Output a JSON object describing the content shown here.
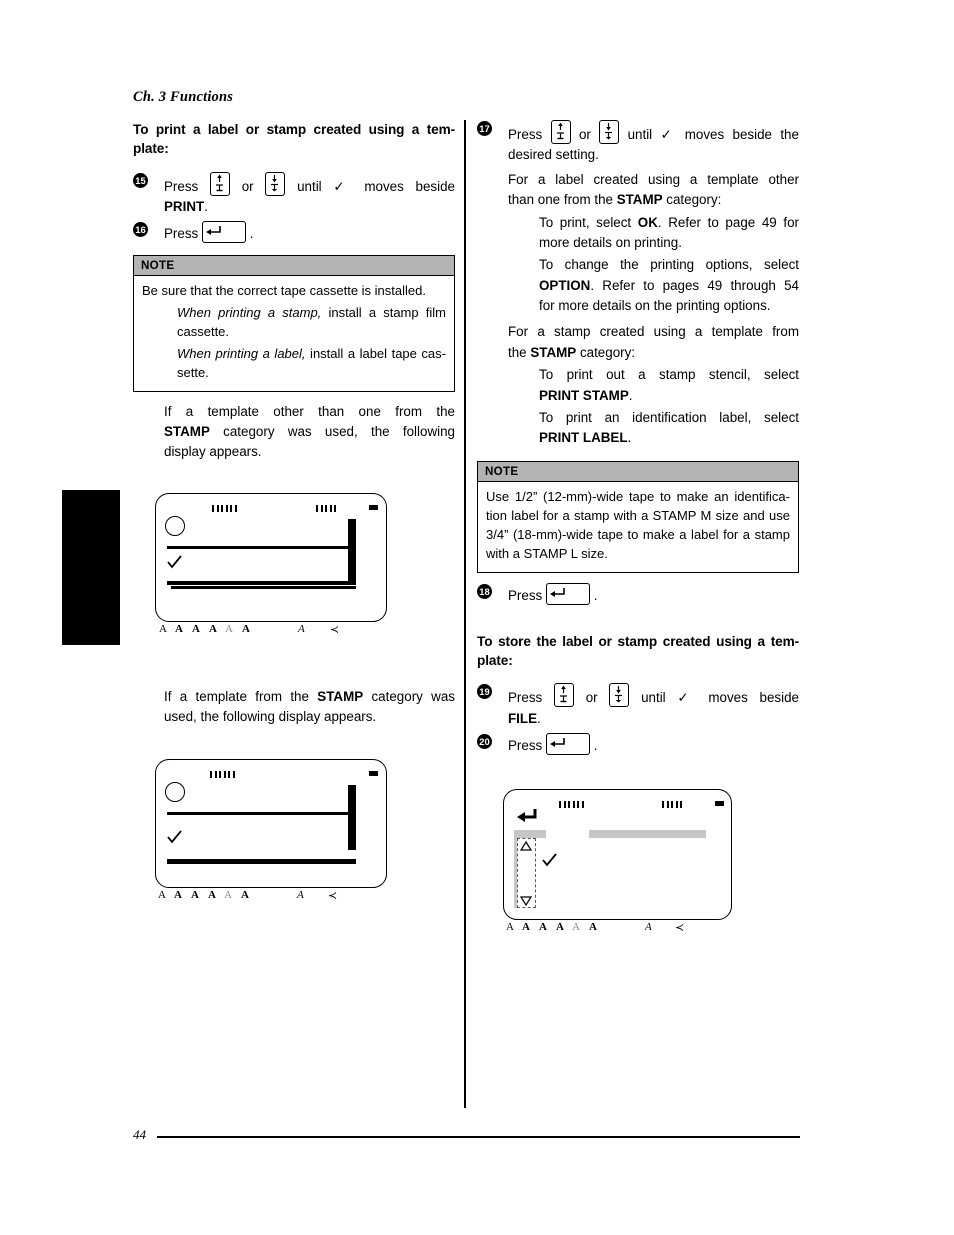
{
  "page": {
    "chapter_header": "Ch. 3 Functions",
    "page_number": "44"
  },
  "left_column": {
    "section_heading_line1": "To print a label or stamp created using a tem-",
    "section_heading_line2": "plate:",
    "step15": {
      "number": "15",
      "text_a": "Press",
      "text_b": "or",
      "text_c": "until ✓ moves beside",
      "text_d": "PRINT",
      "text_e": "."
    },
    "step16": {
      "number": "16",
      "text_a": "Press",
      "text_b": "."
    },
    "note": {
      "header": "NOTE",
      "line1": "Be sure that the correct tape cassette is installed.",
      "item1_em": "When printing a stamp,",
      "item1_rest": " install a stamp film",
      "item1_line2": "cassette.",
      "item2_em": "When printing a label,",
      "item2_rest": " install a label tape cas-",
      "item2_line2": "sette."
    },
    "para_after_note": {
      "line1_a": "If a template other than one from the",
      "line2_bold": "STAMP",
      "line2_rest": " category was used, the following",
      "line3": "display appears."
    },
    "para_stamp": {
      "line1_a": "If a template from the ",
      "line1_bold": "STAMP",
      "line1_b": " category was",
      "line2": "used, the following display appears."
    },
    "lcd1": {
      "name": "display-template-non-stamp",
      "icons": [
        "A",
        "A",
        "A",
        "A",
        "A",
        "A",
        "A",
        "≺"
      ]
    },
    "lcd2": {
      "name": "display-template-stamp",
      "icons": [
        "A",
        "A",
        "A",
        "A",
        "A",
        "A",
        "A",
        "≺"
      ]
    }
  },
  "right_column": {
    "step17": {
      "number": "17",
      "text_a": "Press",
      "text_b": "or",
      "text_c": "until ✓ moves beside the",
      "text_d": "desired setting."
    },
    "para_label": {
      "line1": "For a label created using a template other",
      "line2_a": "than one from the ",
      "line2_bold": "STAMP",
      "line2_b": " category:"
    },
    "sub_ok": {
      "line1_a": "To print, select ",
      "line1_bold": "OK",
      "line1_b": ". Refer to page 49 for",
      "line2": "more details on printing."
    },
    "sub_option": {
      "line1": "To change the printing options, select",
      "line2_bold": "OPTION",
      "line2_rest": ". Refer to pages 49 through 54",
      "line3": "for more details on the printing options."
    },
    "para_stamp": {
      "line1": "For a stamp created using a template from",
      "line2_a": "the ",
      "line2_bold": "STAMP",
      "line2_b": " category:"
    },
    "sub_print_stamp": {
      "line1": "To print out a stamp stencil, select",
      "line2_bold": "PRINT STAMP",
      "line2_rest": "."
    },
    "sub_print_label": {
      "line1": "To print an identification label, select",
      "line2_bold": "PRINT LABEL",
      "line2_rest": "."
    },
    "note": {
      "header": "NOTE",
      "line1": "Use 1/2” (12-mm)-wide tape to make an identifica-",
      "line2": "tion label for a stamp with a STAMP M size and use",
      "line3": "3/4” (18-mm)-wide tape to make a label for a stamp",
      "line4": "with a STAMP L size."
    },
    "step18": {
      "number": "18",
      "text_a": "Press",
      "text_b": "."
    },
    "section_heading_line1": "To store the label or stamp created using a tem-",
    "section_heading_line2": "plate:",
    "step19": {
      "number": "19",
      "text_a": "Press",
      "text_b": "or",
      "text_c": "until ✓ moves beside",
      "text_d": "FILE",
      "text_e": "."
    },
    "step20": {
      "number": "20",
      "text_a": "Press",
      "text_b": "."
    },
    "lcd3": {
      "name": "display-file-store",
      "icons": [
        "A",
        "A",
        "A",
        "A",
        "A",
        "A",
        "A",
        "≺"
      ]
    }
  },
  "icons": {
    "up_arrow": "up-arrow-key",
    "down_arrow": "down-arrow-key",
    "enter_key": "enter-key",
    "check": "✓"
  },
  "colors": {
    "note_header_bg": "#b3b3b3",
    "lcd_gray": "#c6c6c6",
    "ink": "#000000"
  }
}
